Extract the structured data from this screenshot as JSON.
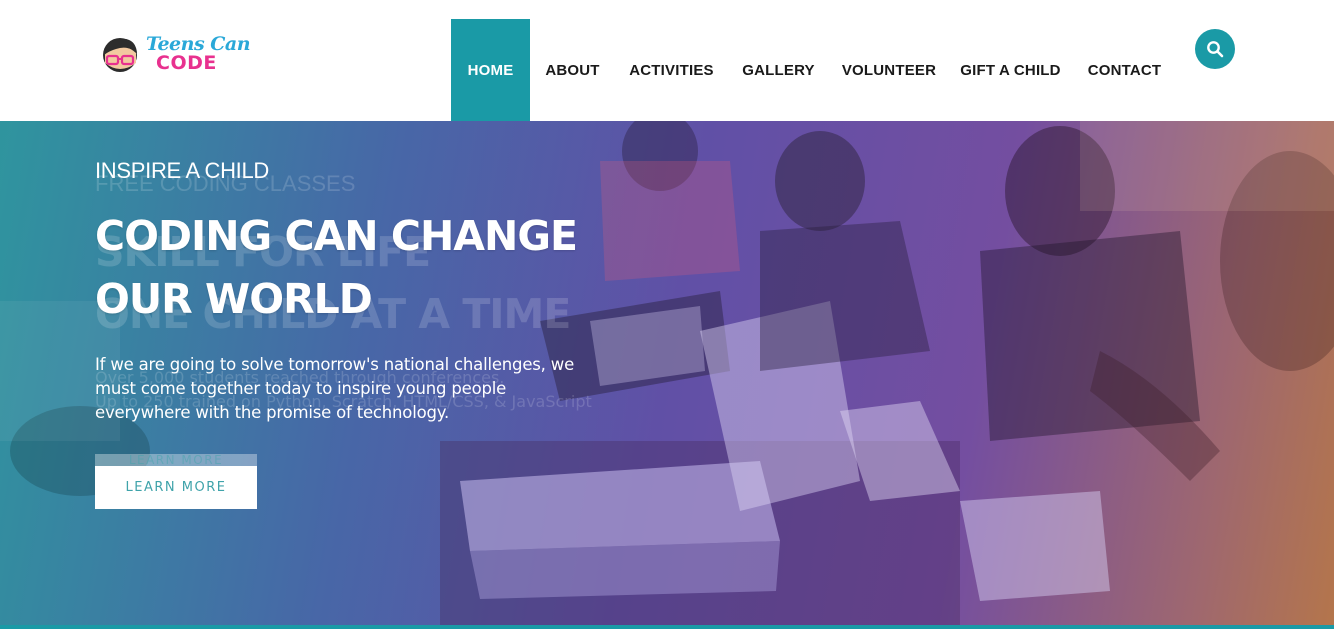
{
  "brand": {
    "logo_line1": "Teens Can",
    "logo_line2": "CODE",
    "colors": {
      "teal": "#1a9aa6",
      "blue": "#2aa8d8",
      "pink": "#e8318f"
    }
  },
  "nav": {
    "items": [
      {
        "label": "HOME",
        "active": true
      },
      {
        "label": "ABOUT",
        "active": false
      },
      {
        "label": "ACTIVITIES",
        "active": false
      },
      {
        "label": "GALLERY",
        "active": false
      },
      {
        "label": "VOLUNTEER",
        "active": false
      },
      {
        "label": "GIFT A CHILD",
        "active": false
      },
      {
        "label": "CONTACT",
        "active": false
      }
    ],
    "search_icon": "search-icon"
  },
  "hero": {
    "eyebrow": "INSPIRE A CHILD",
    "headline_line1": "CODING CAN CHANGE",
    "headline_line2": "OUR WORLD",
    "body": "If we are going to solve tomorrow's national challenges, we must come together today to inspire young people everywhere with the promise of technology.",
    "cta_label": "LEARN MORE",
    "ghost_slide": {
      "eyebrow": "FREE CODING CLASSES",
      "headline_line1": "SKILL FOR LIFE",
      "headline_line2": "ONE CHILD AT A TIME",
      "line1": "Over 5,000 students reached through conferences.",
      "line2": "Up to 250 trained on Python, Scratch, HTML/CSS, & JavaScript",
      "cta_label": "LEARN MORE"
    }
  }
}
